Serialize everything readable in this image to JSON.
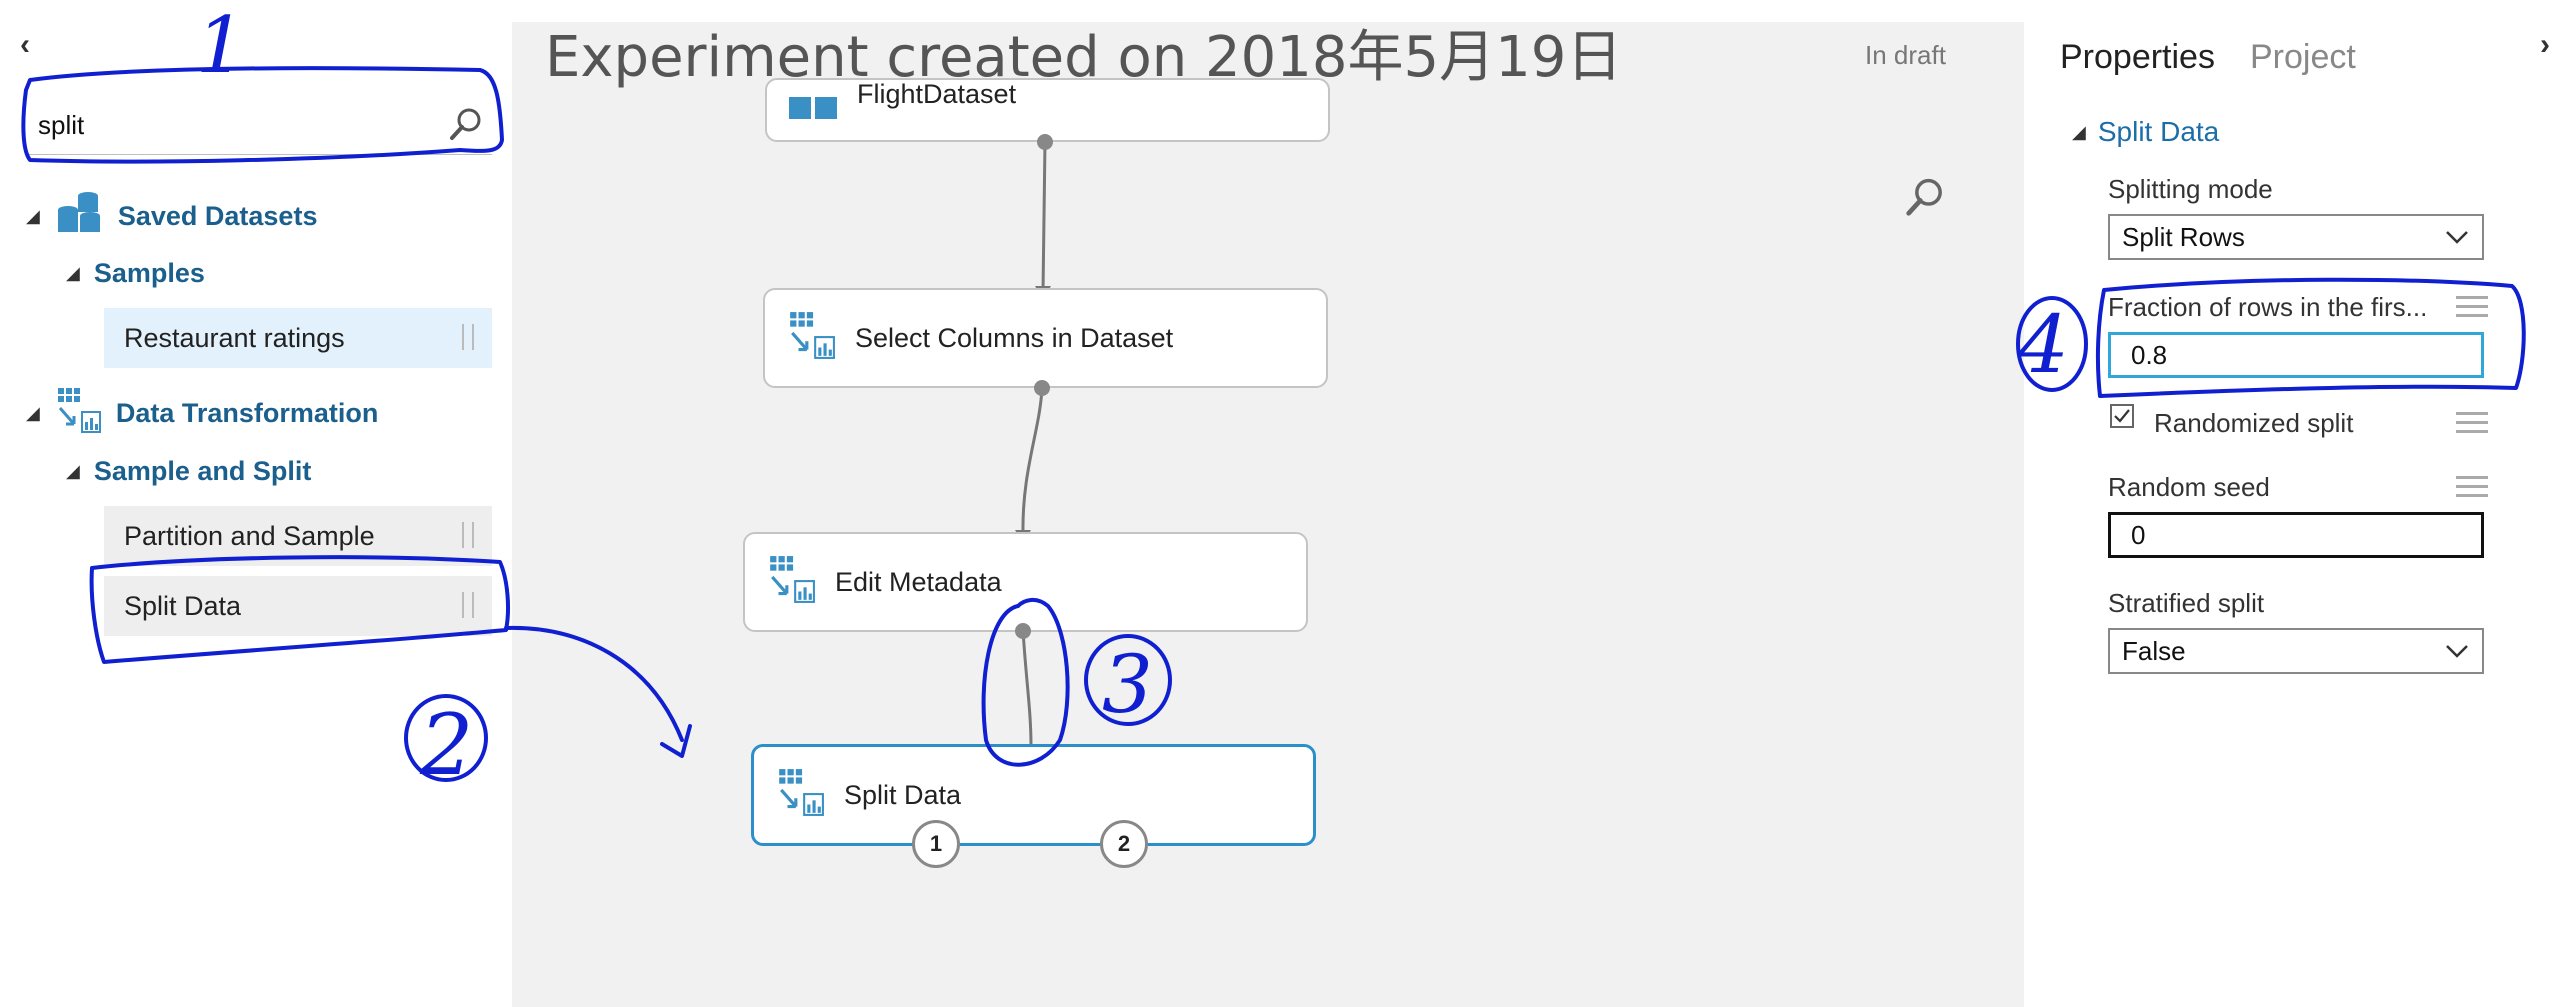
{
  "left_panel": {
    "search": {
      "value": "split",
      "placeholder": ""
    },
    "tree": {
      "saved_datasets": "Saved Datasets",
      "samples": "Samples",
      "restaurant_ratings": "Restaurant ratings",
      "data_transformation": "Data Transformation",
      "sample_and_split": "Sample and Split",
      "partition_and_sample": "Partition and Sample",
      "split_data": "Split Data"
    }
  },
  "canvas": {
    "title": "Experiment created on 2018年5月19日",
    "status": "In draft",
    "modules": {
      "partial_top": "FlightDataset",
      "select_columns": "Select Columns in Dataset",
      "edit_metadata": "Edit Metadata",
      "split_data": "Split Data",
      "output_port_1": "1",
      "output_port_2": "2"
    }
  },
  "properties": {
    "tabs": {
      "properties": "Properties",
      "project": "Project"
    },
    "section_title": "Split Data",
    "splitting_mode": {
      "label": "Splitting mode",
      "value": "Split Rows"
    },
    "fraction": {
      "label": "Fraction of rows in the firs...",
      "value": "0.8"
    },
    "randomized_split": {
      "label": "Randomized split",
      "checked": true
    },
    "random_seed": {
      "label": "Random seed",
      "value": "0"
    },
    "stratified_split": {
      "label": "Stratified split",
      "value": "False"
    }
  },
  "annotations": {
    "n1": "1",
    "n2": "2",
    "n3": "3",
    "n4": "4"
  },
  "colors": {
    "accent": "#1b6ea8",
    "selected_border": "#2b8fc9",
    "ink": "#1020d0",
    "icon_blue": "#3a8fc4"
  }
}
